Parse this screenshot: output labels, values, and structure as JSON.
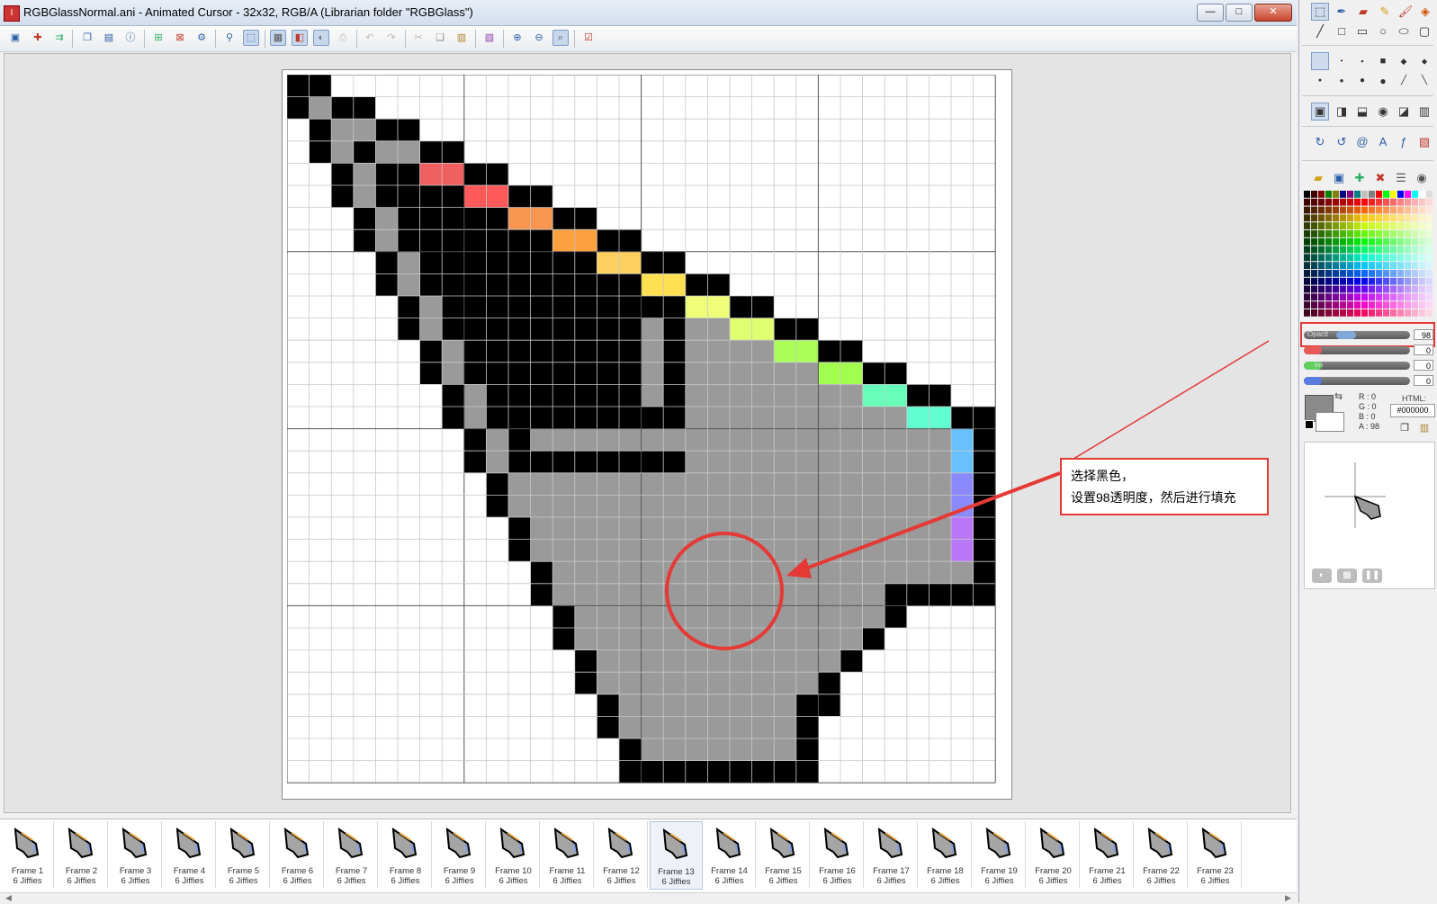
{
  "window": {
    "title": "RGBGlassNormal.ani - Animated Cursor - 32x32, RGB/A (Librarian folder \"RGBGlass\")",
    "app_icon": "I",
    "minimize": "—",
    "maximize": "□",
    "close": "✕"
  },
  "toolbar": {
    "icons": [
      "save-icon",
      "new-frame-icon",
      "import-icon",
      "copy-frame-icon",
      "delete-frame-icon",
      "info-icon",
      "add-icon",
      "remove-icon",
      "settings-icon",
      "pick-icon",
      "select-all-icon",
      "grid-icon",
      "mask-icon",
      "transparent-icon",
      "print-icon",
      "undo-icon",
      "redo-icon",
      "cut-icon",
      "copy-icon",
      "paste-icon",
      "color-adjust-icon",
      "zoom-in-icon",
      "zoom-out-icon",
      "zoom-fit-icon",
      "test-cursor-icon"
    ]
  },
  "canvas": {
    "width": 32,
    "height": 32,
    "colors": {
      ".": "#ffffff",
      "K": "#000000",
      "G": "#9a9a9a",
      "R": "#f06060",
      "P": "#fe5a5a",
      "O": "#f89650",
      "o": "#fca040",
      "Y": "#fed060",
      "y": "#fee050",
      "L": "#eefe78",
      "l": "#e0fe70",
      "g": "#aafe56",
      "h": "#a2fe4e",
      "C": "#66feb8",
      "c": "#60fed0",
      "B": "#68c0fe",
      "b": "#8a8afe",
      "V": "#ba76f8"
    },
    "rows": [
      "KK..............................",
      "KGKK............................",
      ".KGGKK..........................",
      ".KGKGGKK........................",
      "..KGKKRRKK......................",
      "..KGKKKKPPKK....................",
      "...KGKKKKKOOKK..................",
      "...KGKKKKKKKooKK................",
      "....KGKKKKKKKKYYKK..............",
      "....KGKKKKKKKKKKyyKK............",
      ".....KGKKKKKKKKKKKLLKK..........",
      ".....KGKKKKKKKKKGKGGllKK........",
      "......KGKKKKKKKKGKGGGGggKK......",
      "......KGKKKKKKKKGKGGGGGGhhKK....",
      ".......KGKKKKKKKGKGGGGGGGGCCKK..",
      ".......KGKKKKKKKKKGGGGGGGGGGccKK",
      "........KGKGGGGGGGGGGGGGGGGGGGBK",
      "........KGKKKKKKKKGGGGGGGGGGGGBK",
      ".........KGGGGGGGGGGGGGGGGGGGGbK",
      ".........KGGGGGGGGGGGGGGGGGGGGbK",
      "..........KGGGGGGGGGGGGGGGGGGGVK",
      "..........KGGGGGGGGGGGGGGGGGGGVK",
      "...........KGGGGGGGGGGGGGGGGGGGK",
      "...........KGGGGGGGGGGGGGGGKKKKK",
      "............KGGGGGGGGGGGGGGK....",
      "............KGGGGGGGGGGGGGK.....",
      ".............KGGGGGGGGGGGK......",
      ".............KGGGGGGGGGGK.......",
      "..............KGGGGGGGGKK.......",
      "..............KGGGGGGGGK........",
      "...............KGGGGGGGK........",
      "...............KKKKKKKKK........"
    ]
  },
  "annotation": {
    "line1": "选择黑色，",
    "line2": "设置98透明度，然后进行填充",
    "color": "#e53935"
  },
  "filmstrip": {
    "active_index": 12,
    "frames": [
      {
        "name": "Frame 1",
        "duration": "6 Jiffies"
      },
      {
        "name": "Frame 2",
        "duration": "6 Jiffies"
      },
      {
        "name": "Frame 3",
        "duration": "6 Jiffies"
      },
      {
        "name": "Frame 4",
        "duration": "6 Jiffies"
      },
      {
        "name": "Frame 5",
        "duration": "6 Jiffies"
      },
      {
        "name": "Frame 6",
        "duration": "6 Jiffies"
      },
      {
        "name": "Frame 7",
        "duration": "6 Jiffies"
      },
      {
        "name": "Frame 8",
        "duration": "6 Jiffies"
      },
      {
        "name": "Frame 9",
        "duration": "6 Jiffies"
      },
      {
        "name": "Frame 10",
        "duration": "6 Jiffies"
      },
      {
        "name": "Frame 11",
        "duration": "6 Jiffies"
      },
      {
        "name": "Frame 12",
        "duration": "6 Jiffies"
      },
      {
        "name": "Frame 13",
        "duration": "6 Jiffies"
      },
      {
        "name": "Frame 14",
        "duration": "6 Jiffies"
      },
      {
        "name": "Frame 15",
        "duration": "6 Jiffies"
      },
      {
        "name": "Frame 16",
        "duration": "6 Jiffies"
      },
      {
        "name": "Frame 17",
        "duration": "6 Jiffies"
      },
      {
        "name": "Frame 18",
        "duration": "6 Jiffies"
      },
      {
        "name": "Frame 19",
        "duration": "6 Jiffies"
      },
      {
        "name": "Frame 20",
        "duration": "6 Jiffies"
      },
      {
        "name": "Frame 21",
        "duration": "6 Jiffies"
      },
      {
        "name": "Frame 22",
        "duration": "6 Jiffies"
      },
      {
        "name": "Frame 23",
        "duration": "6 Jiffies"
      }
    ]
  },
  "color_panel": {
    "opacity_label": "Opacit",
    "opacity_value": "98",
    "red_value": "0",
    "green_label": "en",
    "green_value": "0",
    "blue_value": "0",
    "r_label": "R :",
    "g_label": "G :",
    "b_label": "B :",
    "a_label": "A :",
    "r": "0",
    "g": "0",
    "b": "0",
    "a": "98",
    "html_label": "HTML:",
    "html_value": "#000000",
    "current_color": "#8a8a8a"
  }
}
